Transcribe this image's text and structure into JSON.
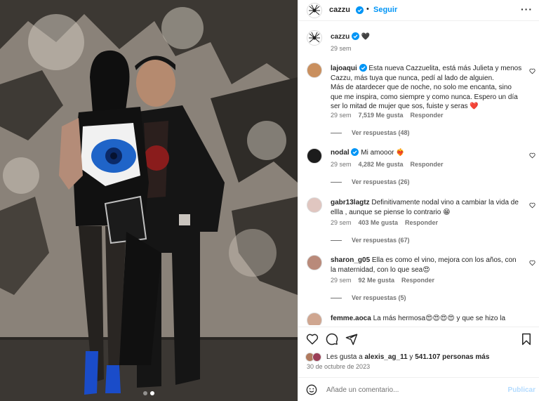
{
  "post": {
    "author": "cazzu",
    "follow_label": "Seguir",
    "more_label": "···",
    "caption_emoji": "🖤",
    "caption_time": "29 sem",
    "carousel_dots": 2
  },
  "comments": [
    {
      "user": "lajoaqui",
      "verified": true,
      "lines": [
        "Esta nueva Cazzuelita, está más Julieta y menos",
        "Cazzu, más tuya que nunca, pedí al lado de alguien.",
        "Más de atardecer que de noche, no solo me encanta, sino",
        "que me inspira, como siempre y como nunca. Espero un día",
        "ser lo mitad de mujer que sos, fuiste y seras ❤️"
      ],
      "time": "29 sem",
      "likes": "7,519 Me gusta",
      "reply_label": "Responder",
      "view_replies": "Ver respuestas (48)"
    },
    {
      "user": "nodal",
      "verified": true,
      "lines": [
        "Mi amooor ❤️‍🔥"
      ],
      "time": "29 sem",
      "likes": "4,282 Me gusta",
      "reply_label": "Responder",
      "view_replies": "Ver respuestas (26)"
    },
    {
      "user": "gabr13lagtz",
      "verified": false,
      "lines": [
        "Definitivamente nodal vino a cambiar la vida de",
        "ellla , aunque se piense lo contrario 😁"
      ],
      "time": "29 sem",
      "likes": "403 Me gusta",
      "reply_label": "Responder",
      "view_replies": "Ver respuestas (67)"
    },
    {
      "user": "sharon_g05",
      "verified": false,
      "lines": [
        "Ella es como el vino, mejora con los años, con",
        "la maternidad, con lo que sea😍"
      ],
      "time": "29 sem",
      "likes": "92 Me gusta",
      "reply_label": "Responder",
      "view_replies": "Ver respuestas (5)"
    },
    {
      "user": "femme.aoca",
      "verified": false,
      "lines": [
        "La más hermosa😍😍😍😍 y que se hizo la"
      ],
      "time": "",
      "likes": "",
      "reply_label": "",
      "view_replies": ""
    }
  ],
  "footer": {
    "likes_prefix": "Les gusta a ",
    "liked_by_user": "alexis_ag_11",
    "likes_middle": " y ",
    "likes_count": "541.107 personas más",
    "date": "30 de octubre de 2023",
    "comment_placeholder": "Añade un comentario...",
    "publish_label": "Publicar"
  },
  "colors": {
    "link_blue": "#0095f6",
    "verified_blue": "#0095f6",
    "publish_disabled": "#b3dbff",
    "muted": "#737373"
  },
  "icons": {
    "like": "heart-icon",
    "comment": "comment-icon",
    "share": "share-icon",
    "save": "bookmark-icon",
    "emoji": "smiley-icon"
  }
}
